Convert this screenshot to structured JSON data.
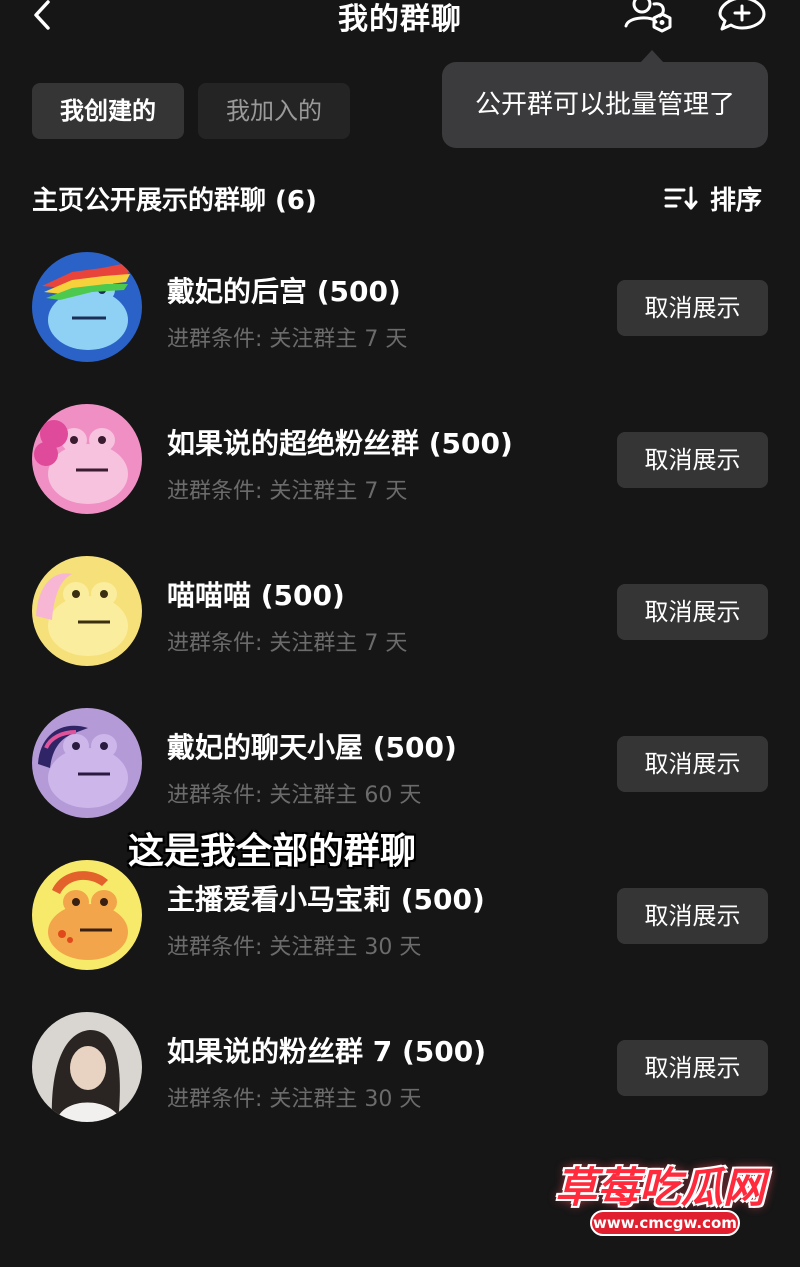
{
  "header": {
    "title": "我的群聊",
    "icons": [
      "back-icon",
      "group-settings-icon",
      "new-chat-icon"
    ]
  },
  "tabs": [
    {
      "label": "我创建的",
      "selected": true
    },
    {
      "label": "我加入的",
      "selected": false
    }
  ],
  "tooltip": {
    "text": "公开群可以批量管理了"
  },
  "section": {
    "title": "主页公开展示的群聊 (6)",
    "sort_label": "排序",
    "sort_icon": "sort-icon"
  },
  "groups": [
    {
      "name": "戴妃的后宫 (500)",
      "condition": "进群条件: 关注群主 7 天",
      "button": "取消展示",
      "avatar": "blue-frog-avatar"
    },
    {
      "name": "如果说的超绝粉丝群 (500)",
      "condition": "进群条件: 关注群主 7 天",
      "button": "取消展示",
      "avatar": "pink-frog-avatar"
    },
    {
      "name": "喵喵喵 (500)",
      "condition": "进群条件: 关注群主 7 天",
      "button": "取消展示",
      "avatar": "yellow-frog-avatar"
    },
    {
      "name": "戴妃的聊天小屋 (500)",
      "condition": "进群条件: 关注群主 60 天",
      "button": "取消展示",
      "avatar": "purple-frog-avatar"
    },
    {
      "name": "主播爱看小马宝莉 (500)",
      "condition": "进群条件: 关注群主 30 天",
      "button": "取消展示",
      "avatar": "orange-frog-avatar"
    },
    {
      "name": "如果说的粉丝群 7 (500)",
      "condition": "进群条件: 关注群主 30 天",
      "button": "取消展示",
      "avatar": "photo-avatar"
    }
  ],
  "overlay": {
    "caption": "这是我全部的群聊"
  },
  "watermark": {
    "title": "草莓吃瓜网",
    "url": "www.cmcgw.com"
  },
  "colors": {
    "background": "#161616",
    "button": "#353535",
    "tooltip": "#3b3b3d",
    "subtext": "#6b6b6b",
    "watermark": "#ff2a3c"
  }
}
